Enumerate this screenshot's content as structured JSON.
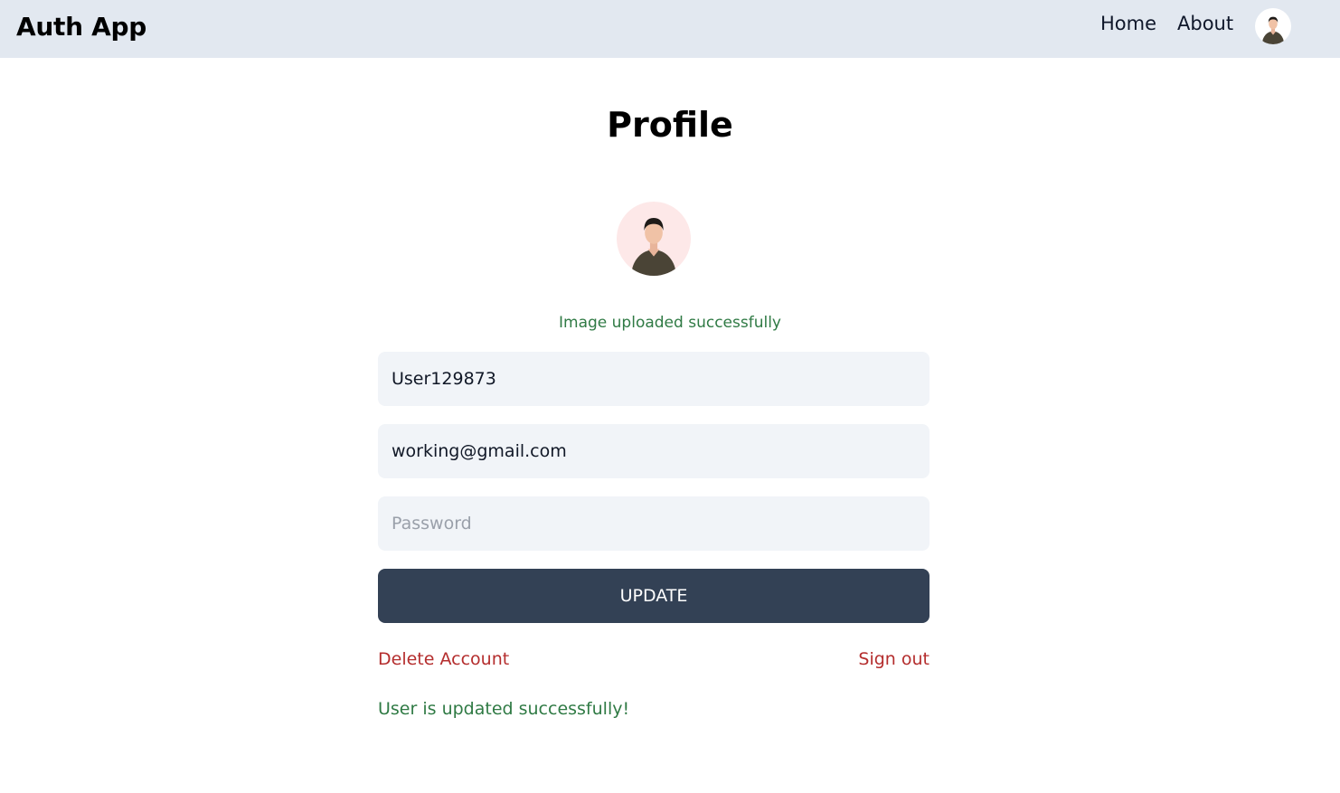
{
  "navbar": {
    "brand": "Auth App",
    "links": [
      {
        "label": "Home"
      },
      {
        "label": "About"
      }
    ]
  },
  "profile": {
    "title": "Profile",
    "upload_message": "Image uploaded successfully",
    "username_value": "User129873",
    "email_value": "working@gmail.com",
    "password_placeholder": "Password",
    "update_label": "UPDATE",
    "delete_label": "Delete Account",
    "signout_label": "Sign out",
    "success_message": "User is updated successfully!"
  },
  "icons": {
    "nav_avatar": "user-avatar-icon",
    "profile_avatar": "user-avatar-icon"
  },
  "colors": {
    "navbar_bg": "#e2e8f0",
    "button_bg": "#334155",
    "danger": "#b42d2d",
    "success": "#2f7a44",
    "input_bg": "#f1f4f8",
    "avatar_bg": "#fde8e8"
  }
}
